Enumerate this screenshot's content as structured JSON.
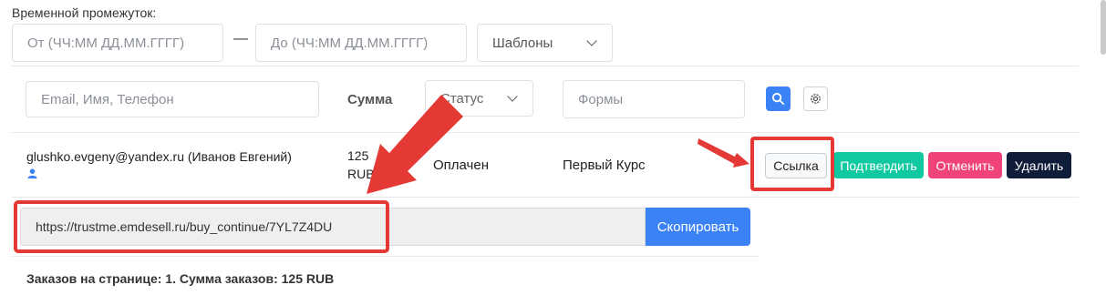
{
  "filters": {
    "period_label": "Временной промежуток:",
    "from_placeholder": "От (ЧЧ:ММ ДД.ММ.ГГГГ)",
    "dash": "—",
    "to_placeholder": "До (ЧЧ:ММ ДД.ММ.ГГГГ)",
    "templates_label": "Шаблоны"
  },
  "table_header": {
    "search_placeholder": "Email, Имя, Телефон",
    "sum_label": "Сумма",
    "status_label": "Статус",
    "forms_placeholder": "Формы"
  },
  "order": {
    "customer": "glushko.evgeny@yandex.ru (Иванов Евгений)",
    "amount": "125",
    "currency": "RUB",
    "status": "Оплачен",
    "form": "Первый Курс",
    "link_button": "Ссылка",
    "confirm_button": "Подтвердить",
    "cancel_button": "Отменить",
    "delete_button": "Удалить"
  },
  "link_row": {
    "url": "https://trustme.emdesell.ru/buy_continue/7YL7Z4DU",
    "copy_button": "Скопировать"
  },
  "summary": "Заказов на странице: 1. Сумма заказов: 125 RUB",
  "colors": {
    "primary": "#3b82f6",
    "confirm": "#10c9a0",
    "cancel": "#f0437a",
    "delete": "#0f1d3a",
    "annotation_red": "#e53935"
  }
}
